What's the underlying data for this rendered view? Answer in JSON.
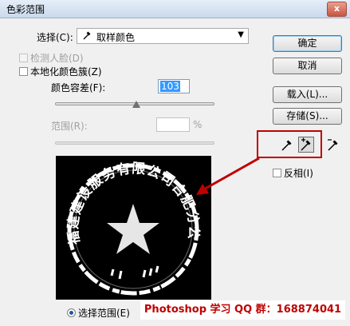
{
  "window": {
    "title": "色彩范围",
    "close_label": "x"
  },
  "select": {
    "label": "选择(C):",
    "value": "取样颜色"
  },
  "detect_faces": {
    "label": "检测人脸(D)",
    "checked": false,
    "enabled": false
  },
  "localized_clusters": {
    "label": "本地化颜色簇(Z)",
    "checked": false
  },
  "fuzziness": {
    "label": "颜色容差(F):",
    "value": "103",
    "slider_fraction": 0.51
  },
  "range": {
    "label": "范围(R):",
    "value": "",
    "unit": "%",
    "enabled": false
  },
  "buttons": {
    "ok": "确定",
    "cancel": "取消",
    "load": "载入(L)...",
    "save": "存储(S)..."
  },
  "invert": {
    "label": "反相(I)",
    "checked": false
  },
  "preview_mode": {
    "label": "选择范围(E)",
    "selected": true
  },
  "seal_text": "福建建设服务有限公司合肥分公司",
  "watermark": "Photoshop 学习 QQ 群：168874041",
  "colors": {
    "annotation_red": "#c00000",
    "selection_blue": "#3399ff"
  }
}
